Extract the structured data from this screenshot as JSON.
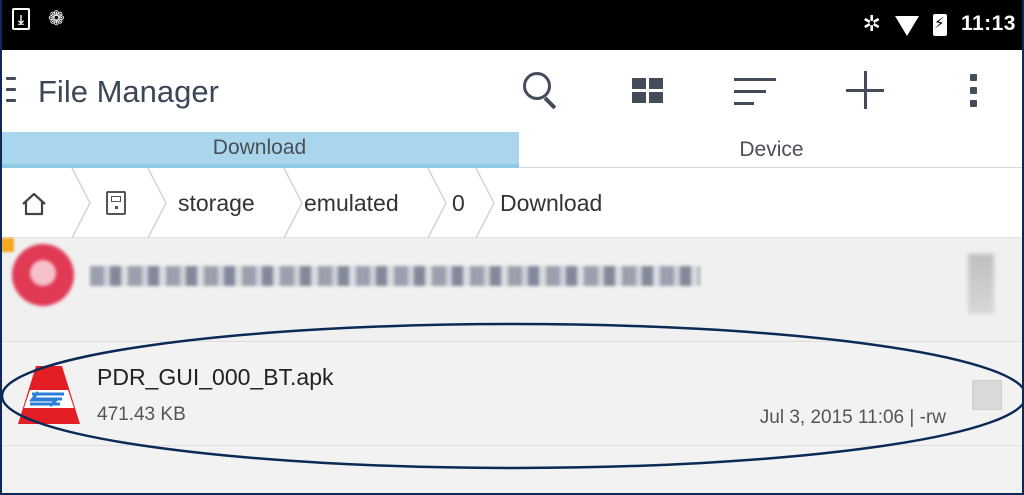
{
  "status_bar": {
    "time": "11:13"
  },
  "app_bar": {
    "title": "File Manager",
    "actions": [
      "search-icon",
      "grid-view-icon",
      "sort-icon",
      "add-icon",
      "more-vert-icon"
    ]
  },
  "tabs": [
    {
      "label": "Download",
      "selected": true
    },
    {
      "label": "Device",
      "selected": false
    }
  ],
  "breadcrumb": [
    "storage",
    "emulated",
    "0",
    "Download"
  ],
  "files": [
    {
      "name": "PDR_GUI_000_BT.apk",
      "size": "471.43 KB",
      "meta": "Jul 3, 2015 11:06 | -rw"
    }
  ],
  "colors": {
    "tab_selected": "#a9d6ec",
    "annotation": "#0b2a55",
    "apk_red": "#e31e24",
    "apk_blue": "#2b7fd6"
  }
}
